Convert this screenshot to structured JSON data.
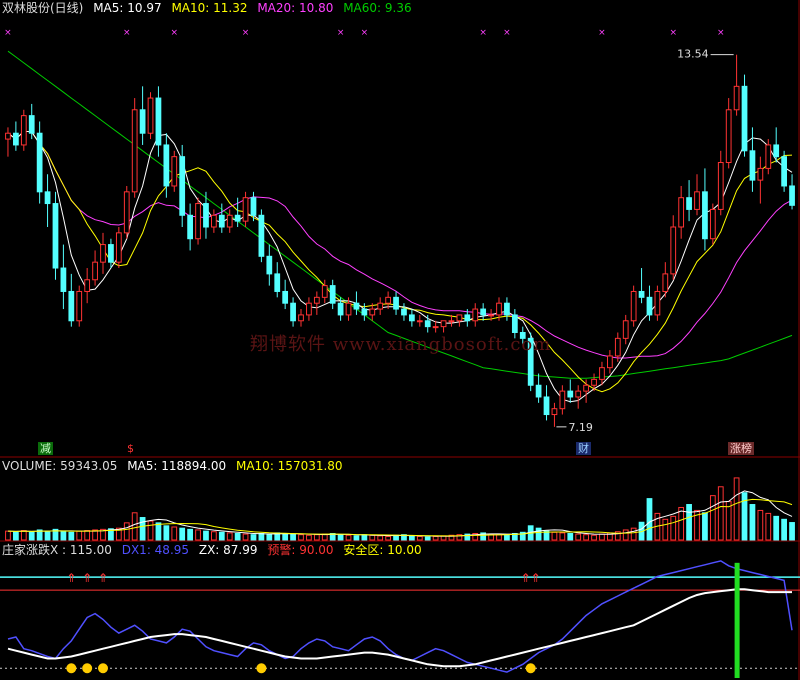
{
  "header": {
    "stock": "双林股份(日线)",
    "ma5_label": "MA5: 10.97",
    "ma10_label": "MA10: 11.32",
    "ma20_label": "MA20: 10.80",
    "ma60_label": "MA60: 9.36"
  },
  "price_panel": {
    "high_label": "13.54",
    "low_label": "7.19",
    "tag_jian": "减",
    "tag_s": "$",
    "tag_cai": "财",
    "tag_zhangbang": "涨榜",
    "watermark": "翔博软件 www.xiangbosoft.com"
  },
  "volume_panel": {
    "volume_label": "VOLUME: 59343.05",
    "ma5_label": "MA5: 118894.00",
    "ma10_label": "MA10: 157031.80"
  },
  "indicator_panel": {
    "name_label": "庄家涨跌X : 115.00",
    "dx1_label": "DX1: 48.95",
    "zx_label": "ZX: 87.99",
    "warn_label": "预警: 90.00",
    "safe_label": "安全区: 10.00"
  },
  "colors": {
    "up": "#ff3333",
    "down": "#54ffff",
    "ma5": "#ffffff",
    "ma10": "#ffff00",
    "ma20": "#ff40ff",
    "ma60": "#00cc00",
    "divider": "#8b0000",
    "indicator_dx1": "#5050ff",
    "indicator_zx": "#ffffff",
    "warn_line": "#54ffff"
  },
  "chart_data": {
    "type": "candlestick",
    "candles": [
      [
        12.1,
        12.3,
        11.8,
        12.2
      ],
      [
        12.2,
        12.4,
        11.9,
        12.0
      ],
      [
        12.0,
        12.6,
        11.9,
        12.5
      ],
      [
        12.5,
        12.7,
        12.1,
        12.2
      ],
      [
        12.2,
        12.4,
        11.0,
        11.2
      ],
      [
        11.2,
        11.5,
        10.6,
        11.0
      ],
      [
        11.0,
        11.2,
        9.7,
        9.9
      ],
      [
        9.9,
        10.3,
        9.2,
        9.5
      ],
      [
        9.5,
        9.8,
        8.9,
        9.0
      ],
      [
        9.0,
        9.6,
        8.9,
        9.5
      ],
      [
        9.5,
        9.9,
        9.3,
        9.7
      ],
      [
        9.7,
        10.2,
        9.6,
        10.0
      ],
      [
        10.0,
        10.5,
        9.8,
        10.3
      ],
      [
        10.3,
        10.4,
        9.9,
        10.0
      ],
      [
        10.0,
        10.6,
        9.9,
        10.5
      ],
      [
        10.5,
        11.3,
        10.4,
        11.2
      ],
      [
        11.2,
        12.8,
        11.1,
        12.6
      ],
      [
        12.6,
        13.0,
        12.0,
        12.2
      ],
      [
        12.2,
        12.9,
        12.1,
        12.8
      ],
      [
        12.8,
        13.0,
        11.8,
        12.0
      ],
      [
        12.0,
        12.2,
        11.1,
        11.3
      ],
      [
        11.3,
        11.9,
        11.2,
        11.8
      ],
      [
        11.8,
        12.0,
        10.6,
        10.8
      ],
      [
        10.8,
        11.0,
        10.2,
        10.4
      ],
      [
        10.4,
        11.1,
        10.3,
        11.0
      ],
      [
        11.0,
        11.2,
        10.4,
        10.6
      ],
      [
        10.6,
        10.9,
        10.5,
        10.8
      ],
      [
        10.8,
        11.0,
        10.5,
        10.6
      ],
      [
        10.6,
        10.9,
        10.5,
        10.8
      ],
      [
        10.8,
        11.1,
        10.6,
        10.7
      ],
      [
        10.7,
        11.2,
        10.6,
        11.1
      ],
      [
        11.1,
        11.2,
        10.7,
        10.8
      ],
      [
        10.8,
        10.9,
        10.0,
        10.1
      ],
      [
        10.1,
        10.3,
        9.6,
        9.8
      ],
      [
        9.8,
        10.0,
        9.4,
        9.5
      ],
      [
        9.5,
        9.7,
        9.2,
        9.3
      ],
      [
        9.3,
        9.4,
        8.9,
        9.0
      ],
      [
        9.0,
        9.2,
        8.9,
        9.1
      ],
      [
        9.1,
        9.4,
        9.0,
        9.3
      ],
      [
        9.3,
        9.5,
        9.1,
        9.4
      ],
      [
        9.4,
        9.7,
        9.3,
        9.6
      ],
      [
        9.6,
        9.7,
        9.2,
        9.3
      ],
      [
        9.3,
        9.4,
        9.0,
        9.1
      ],
      [
        9.1,
        9.4,
        9.0,
        9.3
      ],
      [
        9.3,
        9.5,
        9.1,
        9.2
      ],
      [
        9.2,
        9.3,
        9.0,
        9.1
      ],
      [
        9.1,
        9.3,
        9.0,
        9.2
      ],
      [
        9.2,
        9.4,
        9.1,
        9.3
      ],
      [
        9.3,
        9.5,
        9.2,
        9.4
      ],
      [
        9.4,
        9.5,
        9.1,
        9.2
      ],
      [
        9.2,
        9.3,
        9.0,
        9.1
      ],
      [
        9.1,
        9.2,
        8.9,
        9.0
      ],
      [
        9.0,
        9.1,
        8.9,
        9.0
      ],
      [
        9.0,
        9.1,
        8.8,
        8.9
      ],
      [
        8.9,
        9.0,
        8.8,
        8.9
      ],
      [
        8.9,
        9.0,
        8.8,
        9.0
      ],
      [
        9.0,
        9.1,
        8.9,
        9.0
      ],
      [
        9.0,
        9.1,
        8.9,
        9.1
      ],
      [
        9.1,
        9.2,
        8.9,
        9.0
      ],
      [
        9.0,
        9.3,
        8.9,
        9.2
      ],
      [
        9.2,
        9.3,
        9.0,
        9.1
      ],
      [
        9.1,
        9.2,
        9.0,
        9.1
      ],
      [
        9.1,
        9.4,
        9.0,
        9.3
      ],
      [
        9.3,
        9.4,
        9.0,
        9.1
      ],
      [
        9.1,
        9.2,
        8.7,
        8.8
      ],
      [
        8.8,
        8.9,
        8.6,
        8.7
      ],
      [
        8.7,
        8.8,
        7.8,
        7.9
      ],
      [
        7.9,
        8.1,
        7.6,
        7.7
      ],
      [
        7.7,
        7.9,
        7.3,
        7.4
      ],
      [
        7.4,
        7.6,
        7.19,
        7.5
      ],
      [
        7.5,
        7.9,
        7.4,
        7.8
      ],
      [
        7.8,
        8.0,
        7.6,
        7.7
      ],
      [
        7.7,
        7.9,
        7.5,
        7.8
      ],
      [
        7.8,
        8.0,
        7.6,
        7.9
      ],
      [
        7.9,
        8.1,
        7.8,
        8.0
      ],
      [
        8.0,
        8.3,
        7.9,
        8.2
      ],
      [
        8.2,
        8.5,
        8.1,
        8.4
      ],
      [
        8.4,
        8.8,
        8.3,
        8.7
      ],
      [
        8.7,
        9.1,
        8.6,
        9.0
      ],
      [
        9.0,
        9.6,
        8.9,
        9.5
      ],
      [
        9.5,
        9.9,
        9.3,
        9.4
      ],
      [
        9.4,
        9.6,
        9.0,
        9.1
      ],
      [
        9.1,
        9.6,
        9.0,
        9.5
      ],
      [
        9.5,
        10.0,
        9.4,
        9.8
      ],
      [
        9.8,
        10.8,
        9.7,
        10.6
      ],
      [
        10.6,
        11.3,
        10.4,
        11.1
      ],
      [
        11.1,
        11.4,
        10.7,
        10.9
      ],
      [
        10.9,
        11.5,
        10.8,
        11.2
      ],
      [
        11.2,
        11.6,
        10.2,
        10.4
      ],
      [
        10.4,
        11.0,
        10.3,
        10.9
      ],
      [
        10.9,
        11.9,
        10.8,
        11.7
      ],
      [
        11.7,
        12.8,
        11.6,
        12.6
      ],
      [
        12.6,
        13.54,
        12.5,
        13.0
      ],
      [
        13.0,
        13.2,
        11.8,
        11.9
      ],
      [
        11.9,
        12.3,
        11.2,
        11.4
      ],
      [
        11.4,
        11.8,
        11.0,
        11.6
      ],
      [
        11.6,
        12.1,
        11.5,
        12.0
      ],
      [
        12.0,
        12.3,
        11.7,
        11.8
      ],
      [
        11.8,
        11.9,
        11.2,
        11.3
      ],
      [
        11.3,
        11.5,
        10.9,
        10.97
      ]
    ],
    "volume": [
      30,
      28,
      32,
      26,
      34,
      30,
      36,
      28,
      26,
      30,
      32,
      34,
      36,
      38,
      40,
      58,
      92,
      76,
      64,
      58,
      48,
      44,
      40,
      36,
      34,
      30,
      28,
      26,
      24,
      22,
      20,
      18,
      22,
      20,
      24,
      22,
      20,
      18,
      16,
      18,
      20,
      22,
      18,
      16,
      14,
      18,
      16,
      14,
      12,
      16,
      18,
      14,
      12,
      10,
      12,
      14,
      16,
      18,
      20,
      22,
      24,
      20,
      18,
      16,
      22,
      26,
      48,
      40,
      30,
      26,
      24,
      22,
      20,
      18,
      16,
      20,
      24,
      28,
      34,
      40,
      60,
      140,
      90,
      70,
      80,
      110,
      120,
      100,
      92,
      150,
      180,
      130,
      210,
      160,
      120,
      100,
      90,
      80,
      70,
      59
    ],
    "dx1": [
      40,
      42,
      30,
      28,
      25,
      22,
      20,
      30,
      38,
      50,
      62,
      66,
      60,
      52,
      46,
      50,
      54,
      48,
      40,
      38,
      36,
      42,
      50,
      48,
      40,
      32,
      28,
      26,
      24,
      22,
      30,
      36,
      34,
      28,
      24,
      20,
      22,
      30,
      36,
      40,
      38,
      32,
      30,
      28,
      34,
      40,
      42,
      38,
      30,
      24,
      20,
      18,
      22,
      26,
      30,
      28,
      24,
      20,
      16,
      14,
      12,
      10,
      8,
      6,
      10,
      14,
      20,
      26,
      30,
      34,
      40,
      48,
      56,
      64,
      70,
      76,
      80,
      84,
      88,
      92,
      96,
      100,
      104,
      106,
      108,
      110,
      112,
      114,
      116,
      118,
      120,
      115,
      112,
      110,
      108,
      106,
      104,
      102,
      100,
      48.95
    ],
    "zx": [
      30,
      28,
      26,
      24,
      22,
      20,
      20,
      21,
      22,
      24,
      26,
      28,
      30,
      32,
      34,
      36,
      38,
      40,
      42,
      43,
      44,
      45,
      45,
      44,
      43,
      42,
      40,
      38,
      36,
      34,
      32,
      30,
      28,
      26,
      24,
      22,
      21,
      20,
      20,
      20,
      21,
      22,
      23,
      24,
      25,
      26,
      26,
      25,
      24,
      22,
      20,
      18,
      16,
      14,
      13,
      12,
      12,
      12,
      13,
      14,
      16,
      18,
      20,
      22,
      24,
      26,
      28,
      30,
      32,
      34,
      36,
      38,
      40,
      42,
      44,
      46,
      48,
      50,
      52,
      54,
      58,
      62,
      66,
      70,
      74,
      78,
      82,
      85,
      87,
      88,
      89,
      90,
      91,
      91,
      90,
      89,
      88,
      88,
      88,
      87.99
    ],
    "ma60_curve": [
      13.6,
      13.5,
      13.4,
      13.3,
      13.2,
      13.1,
      13.0,
      12.9,
      12.8,
      12.7,
      12.6,
      12.5,
      12.4,
      12.3,
      12.2,
      12.1,
      12.0,
      11.9,
      11.8,
      11.7,
      11.6,
      11.5,
      11.4,
      11.3,
      11.2,
      11.1,
      11.0,
      10.9,
      10.8,
      10.7,
      10.6,
      10.5,
      10.4,
      10.3,
      10.2,
      10.1,
      10.0,
      9.9,
      9.8,
      9.7,
      9.6,
      9.5,
      9.4,
      9.3,
      9.2,
      9.1,
      9.0,
      8.9,
      8.8,
      8.75,
      8.7,
      8.65,
      8.6,
      8.55,
      8.5,
      8.45,
      8.4,
      8.35,
      8.3,
      8.25,
      8.2,
      8.18,
      8.16,
      8.14,
      8.12,
      8.1,
      8.08,
      8.06,
      8.05,
      8.04,
      8.03,
      8.02,
      8.02,
      8.02,
      8.03,
      8.04,
      8.05,
      8.06,
      8.08,
      8.1,
      8.12,
      8.14,
      8.16,
      8.18,
      8.2,
      8.22,
      8.24,
      8.26,
      8.28,
      8.3,
      8.32,
      8.35,
      8.4,
      8.45,
      8.5,
      8.55,
      8.6,
      8.65,
      8.7,
      8.75
    ],
    "price_ylim": [
      7.0,
      14.2
    ],
    "volume_ylim": [
      0,
      230
    ],
    "indicator_ylim": [
      0,
      125
    ],
    "warn_level": 90,
    "safe_level": 10
  }
}
